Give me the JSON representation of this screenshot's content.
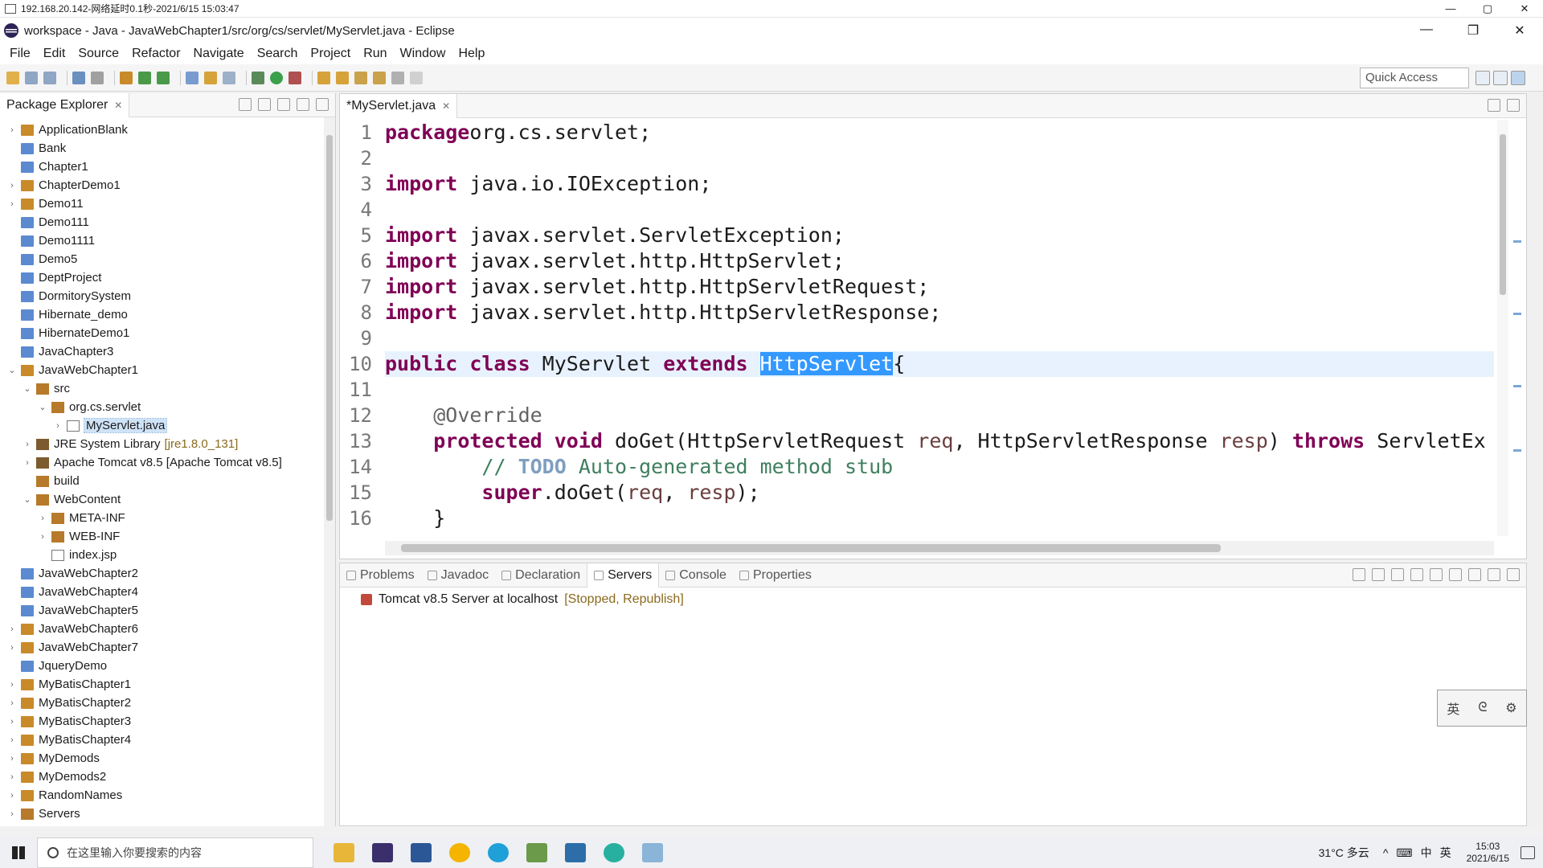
{
  "remote_session": {
    "title": "192.168.20.142-网络延时0.1秒-2021/6/15 15:03:47",
    "controls": [
      "—",
      "▢",
      "✕"
    ]
  },
  "window": {
    "title": "workspace - Java - JavaWebChapter1/src/org/cs/servlet/MyServlet.java - Eclipse",
    "controls": [
      "—",
      "❐",
      "✕"
    ]
  },
  "menu": [
    "File",
    "Edit",
    "Source",
    "Refactor",
    "Navigate",
    "Search",
    "Project",
    "Run",
    "Window",
    "Help"
  ],
  "toolbar": {
    "quick_access": "Quick Access"
  },
  "package_explorer": {
    "title": "Package Explorer",
    "items": [
      {
        "label": "ApplicationBlank",
        "level": 0,
        "twisty": "›",
        "icon": "project-icon"
      },
      {
        "label": "Bank",
        "level": 0,
        "twisty": "",
        "icon": "folder-icon"
      },
      {
        "label": "Chapter1",
        "level": 0,
        "twisty": "",
        "icon": "folder-icon"
      },
      {
        "label": "ChapterDemo1",
        "level": 0,
        "twisty": "›",
        "icon": "project-icon"
      },
      {
        "label": "Demo11",
        "level": 0,
        "twisty": "›",
        "icon": "project-icon"
      },
      {
        "label": "Demo111",
        "level": 0,
        "twisty": "",
        "icon": "folder-icon"
      },
      {
        "label": "Demo1111",
        "level": 0,
        "twisty": "",
        "icon": "folder-icon"
      },
      {
        "label": "Demo5",
        "level": 0,
        "twisty": "",
        "icon": "folder-icon"
      },
      {
        "label": "DeptProject",
        "level": 0,
        "twisty": "",
        "icon": "folder-icon"
      },
      {
        "label": "DormitorySystem",
        "level": 0,
        "twisty": "",
        "icon": "folder-icon"
      },
      {
        "label": "Hibernate_demo",
        "level": 0,
        "twisty": "",
        "icon": "folder-icon"
      },
      {
        "label": "HibernateDemo1",
        "level": 0,
        "twisty": "",
        "icon": "folder-icon"
      },
      {
        "label": "JavaChapter3",
        "level": 0,
        "twisty": "",
        "icon": "folder-icon"
      },
      {
        "label": "JavaWebChapter1",
        "level": 0,
        "twisty": "⌄",
        "icon": "project-icon"
      },
      {
        "label": "src",
        "level": 1,
        "twisty": "⌄",
        "icon": "pkg-icon"
      },
      {
        "label": "org.cs.servlet",
        "level": 2,
        "twisty": "⌄",
        "icon": "pkg-icon"
      },
      {
        "label": "MyServlet.java",
        "level": 3,
        "twisty": "›",
        "icon": "file-icon",
        "selected": true
      },
      {
        "label": "JRE System Library",
        "level": 1,
        "twisty": "›",
        "icon": "lib-icon",
        "decor": "[jre1.8.0_131]"
      },
      {
        "label": "Apache Tomcat v8.5 [Apache Tomcat v8.5]",
        "level": 1,
        "twisty": "›",
        "icon": "lib-icon"
      },
      {
        "label": "build",
        "level": 1,
        "twisty": "",
        "icon": "pkg-icon"
      },
      {
        "label": "WebContent",
        "level": 1,
        "twisty": "⌄",
        "icon": "pkg-icon"
      },
      {
        "label": "META-INF",
        "level": 2,
        "twisty": "›",
        "icon": "pkg-icon"
      },
      {
        "label": "WEB-INF",
        "level": 2,
        "twisty": "›",
        "icon": "pkg-icon"
      },
      {
        "label": "index.jsp",
        "level": 2,
        "twisty": "",
        "icon": "file-icon"
      },
      {
        "label": "JavaWebChapter2",
        "level": 0,
        "twisty": "",
        "icon": "folder-icon"
      },
      {
        "label": "JavaWebChapter4",
        "level": 0,
        "twisty": "",
        "icon": "folder-icon"
      },
      {
        "label": "JavaWebChapter5",
        "level": 0,
        "twisty": "",
        "icon": "folder-icon"
      },
      {
        "label": "JavaWebChapter6",
        "level": 0,
        "twisty": "›",
        "icon": "project-icon"
      },
      {
        "label": "JavaWebChapter7",
        "level": 0,
        "twisty": "›",
        "icon": "project-icon"
      },
      {
        "label": "JqueryDemo",
        "level": 0,
        "twisty": "",
        "icon": "folder-icon"
      },
      {
        "label": "MyBatisChapter1",
        "level": 0,
        "twisty": "›",
        "icon": "project-icon"
      },
      {
        "label": "MyBatisChapter2",
        "level": 0,
        "twisty": "›",
        "icon": "project-icon"
      },
      {
        "label": "MyBatisChapter3",
        "level": 0,
        "twisty": "›",
        "icon": "project-icon"
      },
      {
        "label": "MyBatisChapter4",
        "level": 0,
        "twisty": "›",
        "icon": "project-icon"
      },
      {
        "label": "MyDemods",
        "level": 0,
        "twisty": "›",
        "icon": "project-icon"
      },
      {
        "label": "MyDemods2",
        "level": 0,
        "twisty": "›",
        "icon": "project-icon"
      },
      {
        "label": "RandomNames",
        "level": 0,
        "twisty": "›",
        "icon": "project-icon"
      },
      {
        "label": "Servers",
        "level": 0,
        "twisty": "›",
        "icon": "pkg-icon"
      }
    ]
  },
  "editor": {
    "tab_label": "*MyServlet.java",
    "current_line": 10,
    "lines": [
      {
        "n": "1",
        "tokens": [
          [
            "kw",
            "package"
          ],
          [
            "",
            "org.cs.servlet;"
          ]
        ]
      },
      {
        "n": "2",
        "tokens": []
      },
      {
        "n": "3",
        "tokens": [
          [
            "kw",
            "import"
          ],
          [
            "",
            " java.io.IOException;"
          ]
        ]
      },
      {
        "n": "4",
        "tokens": []
      },
      {
        "n": "5",
        "tokens": [
          [
            "kw",
            "import"
          ],
          [
            "",
            " javax.servlet.ServletException;"
          ]
        ]
      },
      {
        "n": "6",
        "tokens": [
          [
            "kw",
            "import"
          ],
          [
            "",
            " javax.servlet.http.HttpServlet;"
          ]
        ]
      },
      {
        "n": "7",
        "tokens": [
          [
            "kw",
            "import"
          ],
          [
            "",
            " javax.servlet.http.HttpServletRequest;"
          ]
        ]
      },
      {
        "n": "8",
        "tokens": [
          [
            "kw",
            "import"
          ],
          [
            "",
            " javax.servlet.http.HttpServletResponse;"
          ]
        ]
      },
      {
        "n": "9",
        "tokens": []
      },
      {
        "n": "10",
        "tokens": [
          [
            "kw",
            "public class"
          ],
          [
            "",
            " MyServlet "
          ],
          [
            "kw",
            "extends"
          ],
          [
            "",
            " "
          ],
          [
            "highlight",
            "HttpServlet"
          ],
          [
            "",
            "{"
          ]
        ]
      },
      {
        "n": "11",
        "tokens": []
      },
      {
        "n": "12",
        "tokens": [
          [
            "",
            "    "
          ],
          [
            "ann",
            "@Override"
          ]
        ]
      },
      {
        "n": "13",
        "tokens": [
          [
            "",
            "    "
          ],
          [
            "kw",
            "protected void"
          ],
          [
            "",
            " doGet(HttpServletRequest "
          ],
          [
            "param",
            "req"
          ],
          [
            "",
            ", HttpServletResponse "
          ],
          [
            "param",
            "resp"
          ],
          [
            "",
            ") "
          ],
          [
            "kw",
            "throws"
          ],
          [
            "",
            " ServletEx"
          ]
        ]
      },
      {
        "n": "14",
        "tokens": [
          [
            "",
            "        "
          ],
          [
            "cm",
            "// "
          ],
          [
            "todo",
            "TODO"
          ],
          [
            "cm",
            " Auto-generated method stub"
          ]
        ]
      },
      {
        "n": "15",
        "tokens": [
          [
            "",
            "        "
          ],
          [
            "kw",
            "super"
          ],
          [
            "",
            ".doGet("
          ],
          [
            "param",
            "req"
          ],
          [
            "",
            ", "
          ],
          [
            "param",
            "resp"
          ],
          [
            "",
            ");"
          ]
        ]
      },
      {
        "n": "16",
        "tokens": [
          [
            "",
            "    }"
          ]
        ]
      }
    ]
  },
  "bottom_views": {
    "tabs": [
      {
        "label": "Problems",
        "active": false
      },
      {
        "label": "Javadoc",
        "active": false
      },
      {
        "label": "Declaration",
        "active": false
      },
      {
        "label": "Servers",
        "active": true
      },
      {
        "label": "Console",
        "active": false
      },
      {
        "label": "Properties",
        "active": false
      }
    ],
    "server": {
      "name": "Tomcat v8.5 Server at localhost",
      "state": "[Stopped, Republish]"
    }
  },
  "ime": [
    "英",
    "ᘓ",
    "⚙"
  ],
  "taskbar": {
    "search_placeholder": "在这里输入你要搜索的内容",
    "weather": "31°C 多云",
    "tray_glyphs": [
      "^",
      "⌨",
      "中",
      "英"
    ],
    "time": "15:03",
    "date": "2021/6/15"
  },
  "colors": {
    "keyword": "#7f0055",
    "comment": "#3f7f5f",
    "selection": "#3399ff",
    "current_line": "#e8f2fe"
  }
}
